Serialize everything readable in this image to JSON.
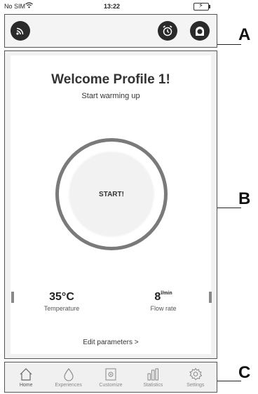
{
  "status_bar": {
    "carrier": "No SIM",
    "time": "13:22"
  },
  "header": {
    "label": "A"
  },
  "main": {
    "label": "B",
    "title": "Welcome Profile 1!",
    "subtitle": "Start warming up",
    "start_label": "START!",
    "temperature": {
      "value": "35°C",
      "label": "Temperature"
    },
    "flow": {
      "value": "8",
      "unit": "l/min",
      "label": "Flow rate"
    },
    "edit_link": "Edit parameters  >"
  },
  "nav": {
    "label": "C",
    "items": [
      {
        "label": "Home",
        "icon": "home-icon"
      },
      {
        "label": "Experiences",
        "icon": "drop-icon"
      },
      {
        "label": "Customize",
        "icon": "customize-icon"
      },
      {
        "label": "Statistics",
        "icon": "statistics-icon"
      },
      {
        "label": "Settings",
        "icon": "gear-icon"
      }
    ]
  }
}
